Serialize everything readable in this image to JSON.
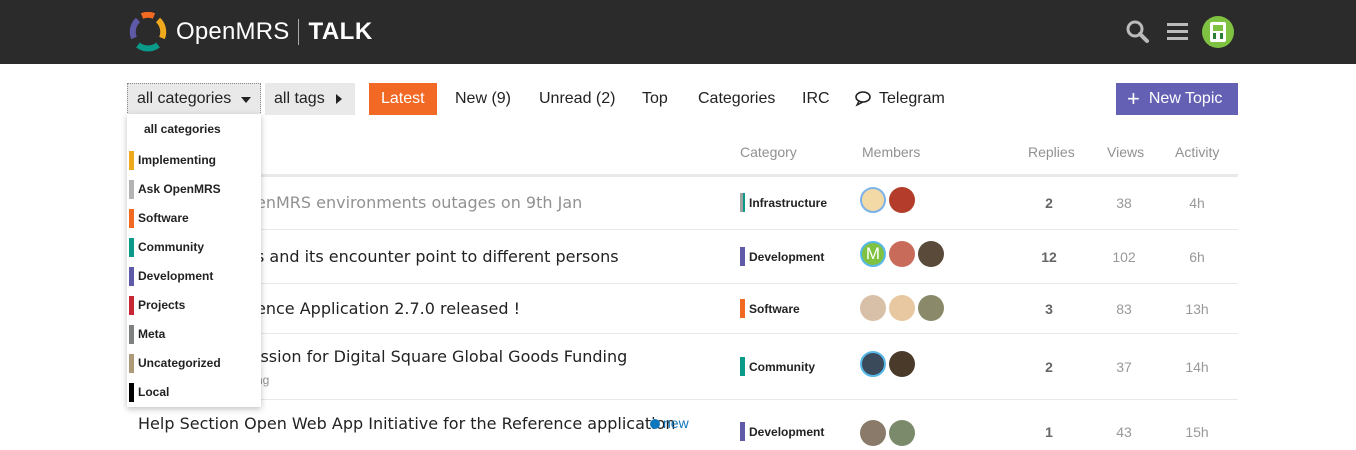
{
  "header": {
    "brand": "OpenMRS",
    "product": "TALK",
    "icons": [
      "search-icon",
      "hamburger-menu-icon",
      "user-avatar"
    ]
  },
  "nav": {
    "category_filter": "all categories",
    "tags_filter": "all tags",
    "links": [
      "Latest",
      "New (9)",
      "Unread (2)",
      "Top",
      "Categories",
      "IRC",
      "Telegram"
    ],
    "active": "Latest",
    "new_topic": "New Topic",
    "accent_color": "#f16924",
    "new_topic_color": "#6461b5"
  },
  "category_menu": {
    "header": "all categories",
    "items": [
      {
        "label": "Implementing",
        "color": "#f0a81c"
      },
      {
        "label": "Ask OpenMRS",
        "color": "#b3b3b3"
      },
      {
        "label": "Software",
        "color": "#f26922"
      },
      {
        "label": "Community",
        "color": "#0a9a8a"
      },
      {
        "label": "Development",
        "color": "#5e5aa8"
      },
      {
        "label": "Projects",
        "color": "#c72634"
      },
      {
        "label": "Meta",
        "color": "#808281"
      },
      {
        "label": "Uncategorized",
        "color": "#ac9a79"
      },
      {
        "label": "Local",
        "color": "#000000"
      }
    ]
  },
  "table": {
    "columns": [
      "Category",
      "Members",
      "Replies",
      "Views",
      "Activity"
    ],
    "rows": [
      {
        "title": "enMRS environments outages on 9th Jan",
        "subtitle": "",
        "category": "Infrastructure",
        "replies": "2",
        "views": "38",
        "activity": "4h",
        "muted": true
      },
      {
        "title": "s and its encounter point to different persons",
        "subtitle": "",
        "category": "Development",
        "replies": "12",
        "views": "102",
        "activity": "6h",
        "muted": false
      },
      {
        "title": "ence Application 2.7.0 released !",
        "subtitle": "",
        "category": "Software",
        "replies": "3",
        "views": "83",
        "activity": "13h",
        "muted": false
      },
      {
        "title": "ission for Digital Square Global Goods Funding",
        "subtitle": "ng",
        "category": "Community",
        "replies": "2",
        "views": "37",
        "activity": "14h",
        "muted": false
      },
      {
        "title": "Help Section Open Web App Initiative for the Reference application",
        "subtitle": "",
        "category": "Development",
        "replies": "1",
        "views": "43",
        "activity": "15h",
        "muted": false,
        "badge": "new"
      }
    ]
  }
}
